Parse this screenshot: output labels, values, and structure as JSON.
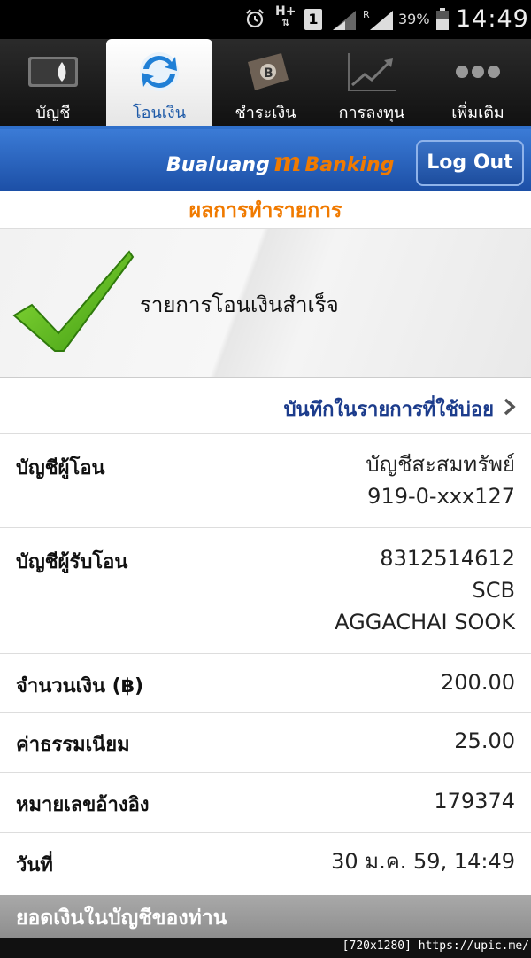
{
  "status_bar": {
    "network_type": "H+",
    "sim_slot": "1",
    "roaming_indicator": "R",
    "battery_percent": "39%",
    "time": "14:49"
  },
  "tabs": [
    {
      "label": "บัญชี",
      "icon": "wallet-icon",
      "active": false
    },
    {
      "label": "โอนเงิน",
      "icon": "transfer-arrows-icon",
      "active": true
    },
    {
      "label": "ชำระเงิน",
      "icon": "bill-payment-icon",
      "active": false
    },
    {
      "label": "การลงทุน",
      "icon": "investment-chart-icon",
      "active": false
    },
    {
      "label": "เพิ่มเติม",
      "icon": "more-dots-icon",
      "active": false
    }
  ],
  "header": {
    "brand_left": "Bualuang",
    "brand_m": "m",
    "brand_right": "Banking",
    "logout_label": "Log Out"
  },
  "result": {
    "title": "ผลการทำรายการ",
    "success_message": "รายการโอนเงินสำเร็จ",
    "save_favorite_label": "บันทึกในรายการที่ใช้บ่อย"
  },
  "details": {
    "from_account": {
      "label": "บัญชีผู้โอน",
      "lines": [
        "บัญชีสะสมทรัพย์",
        "919-0-xxx127"
      ]
    },
    "to_account": {
      "label": "บัญชีผู้รับโอน",
      "lines": [
        "8312514612",
        "SCB",
        "AGGACHAI SOOK"
      ]
    },
    "amount": {
      "label": "จำนวนเงิน (฿)",
      "value": "200.00"
    },
    "fee": {
      "label": "ค่าธรรมเนียม",
      "value": "25.00"
    },
    "reference": {
      "label": "หมายเลขอ้างอิง",
      "value": "179374"
    },
    "date": {
      "label": "วันที่",
      "value": "30 ม.ค. 59, 14:49"
    }
  },
  "balance_section": {
    "label": "ยอดเงินในบัญชีของท่าน"
  },
  "watermark": "[720x1280] https://upic.me/",
  "colors": {
    "accent_orange": "#f07a00",
    "header_blue": "#1c4fa6",
    "success_green": "#5fc01e",
    "link_navy": "#1c3c8c"
  }
}
